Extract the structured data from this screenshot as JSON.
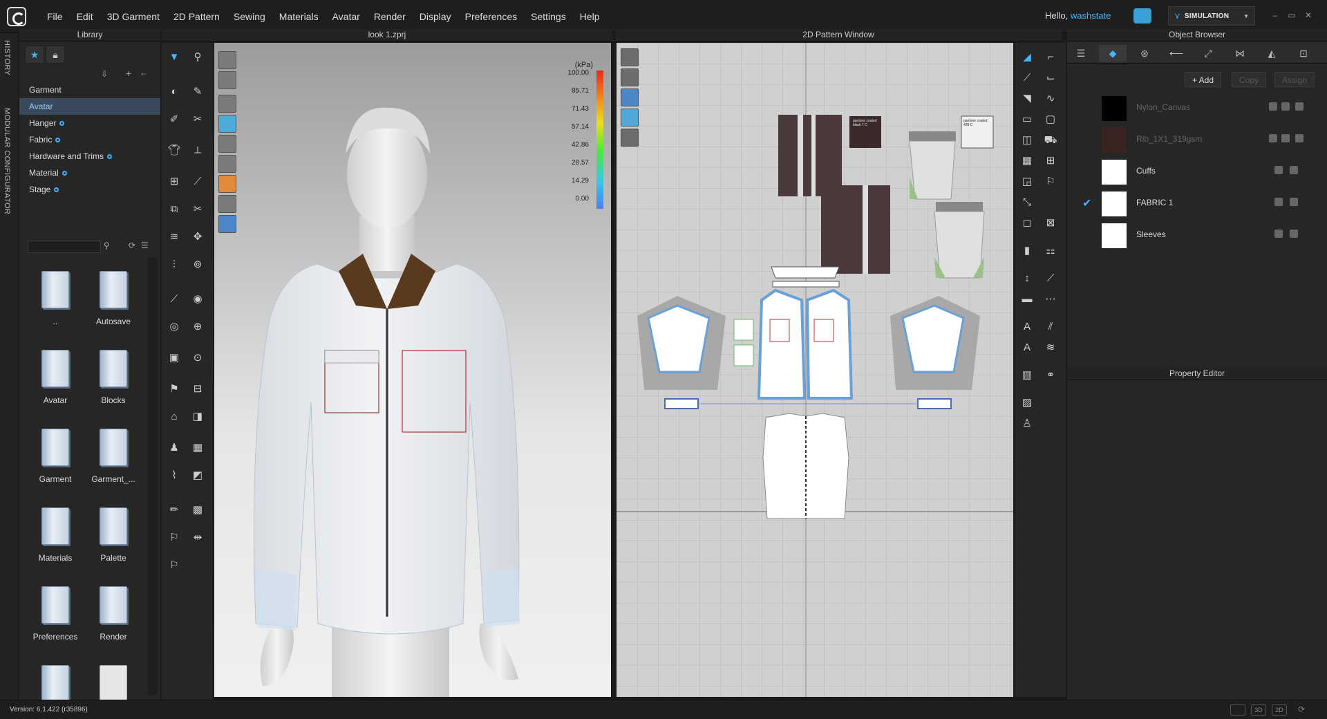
{
  "app": {
    "menu": [
      "File",
      "Edit",
      "3D Garment",
      "2D Pattern",
      "Sewing",
      "Materials",
      "Avatar",
      "Render",
      "Display",
      "Preferences",
      "Settings",
      "Help"
    ],
    "greeting": "Hello, ",
    "username": "washstate",
    "mode": "SIMULATION"
  },
  "side_tabs": [
    "HISTORY",
    "MODULAR CONFIGURATOR"
  ],
  "library": {
    "title": "Library",
    "tree": [
      "Garment",
      "Avatar",
      "Hanger",
      "Fabric",
      "Hardware and Trims",
      "Material",
      "Stage"
    ],
    "selected": "Avatar",
    "folders": [
      "..",
      "Autosave",
      "Avatar",
      "Blocks",
      "Garment",
      "Garment_...",
      "Materials",
      "Palette",
      "Preferences",
      "Render"
    ]
  },
  "view3d": {
    "title": "look 1.zprj",
    "legend": {
      "unit": "(kPa)",
      "values": [
        "100.00",
        "85.71",
        "71.43",
        "57.14",
        "42.86",
        "28.57",
        "14.29",
        "0.00"
      ]
    }
  },
  "view2d": {
    "title": "2D Pattern Window",
    "swatch1": "pantone coated black 7 C",
    "swatch2": "pantone coated 428 C"
  },
  "object_browser": {
    "title": "Object Browser",
    "buttons": {
      "add": "+ Add",
      "copy": "Copy",
      "assign": "Assign"
    },
    "materials": [
      {
        "name": "Nylon_Canvas",
        "color": "#000000",
        "disabled": true
      },
      {
        "name": "Rib_1X1_319gsm",
        "color": "#3a2420",
        "disabled": true
      },
      {
        "name": "Cuffs",
        "color": "#ffffff",
        "disabled": false
      },
      {
        "name": "FABRIC 1",
        "color": "#ffffff",
        "disabled": false,
        "checked": true
      },
      {
        "name": "Sleeves",
        "color": "#ffffff",
        "disabled": false
      }
    ]
  },
  "property_editor": {
    "title": "Property Editor"
  },
  "status": {
    "version": "Version: 6.1.422 (r35896)",
    "view_3d": "3D",
    "view_2d": "2D"
  }
}
